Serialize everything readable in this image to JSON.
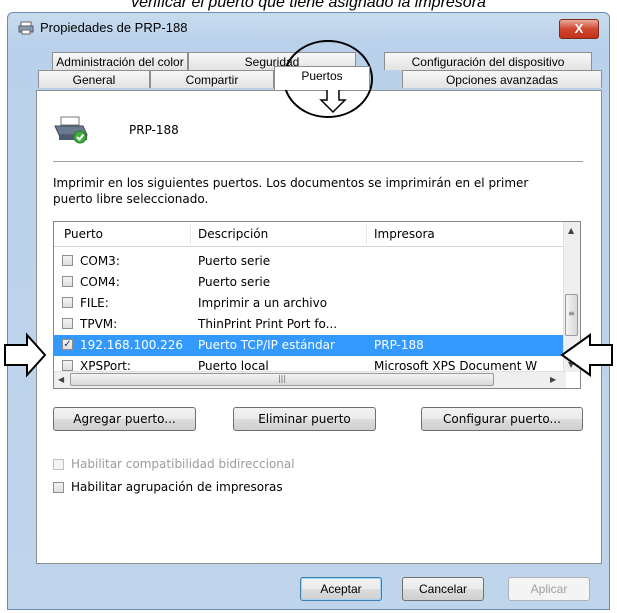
{
  "caption": "verificar el puerto que tiene asignado la impresora",
  "window": {
    "title": "Propiedades de PRP-188",
    "close_label": "X"
  },
  "tabs": {
    "row1": [
      "Administración del color",
      "Seguridad",
      "Configuración del dispositivo"
    ],
    "row2": [
      "General",
      "Compartir",
      "Puertos",
      "Opciones avanzadas"
    ],
    "active": "Puertos"
  },
  "printer": {
    "name": "PRP-188",
    "icon": "printer-icon"
  },
  "intro_text": "Imprimir en los siguientes puertos. Los documentos se imprimirán en el primer puerto libre seleccionado.",
  "ports": {
    "columns": [
      "Puerto",
      "Descripción",
      "Impresora"
    ],
    "rows": [
      {
        "port": "COM3:",
        "description": "Puerto serie",
        "printer": "",
        "checked": false,
        "selected": false
      },
      {
        "port": "COM4:",
        "description": "Puerto serie",
        "printer": "",
        "checked": false,
        "selected": false
      },
      {
        "port": "FILE:",
        "description": "Imprimir a un archivo",
        "printer": "",
        "checked": false,
        "selected": false
      },
      {
        "port": "TPVM:",
        "description": "ThinPrint Print Port fo...",
        "printer": "",
        "checked": false,
        "selected": false
      },
      {
        "port": "192.168.100.226",
        "description": "Puerto TCP/IP estándar",
        "printer": "PRP-188",
        "checked": true,
        "selected": true
      },
      {
        "port": "XPSPort:",
        "description": "Puerto local",
        "printer": "Microsoft XPS Document W",
        "checked": false,
        "selected": false
      }
    ]
  },
  "buttons": {
    "add_port": "Agregar puerto...",
    "delete_port": "Eliminar puerto",
    "configure_port": "Configurar puerto..."
  },
  "options": {
    "bidirectional": "Habilitar compatibilidad bidireccional",
    "pooling": "Habilitar agrupación de impresoras"
  },
  "footer": {
    "ok": "Aceptar",
    "cancel": "Cancelar",
    "apply": "Aplicar"
  },
  "colors": {
    "selection": "#3399ff",
    "titlebar": "#b9d1ea",
    "close": "#c2321a"
  }
}
